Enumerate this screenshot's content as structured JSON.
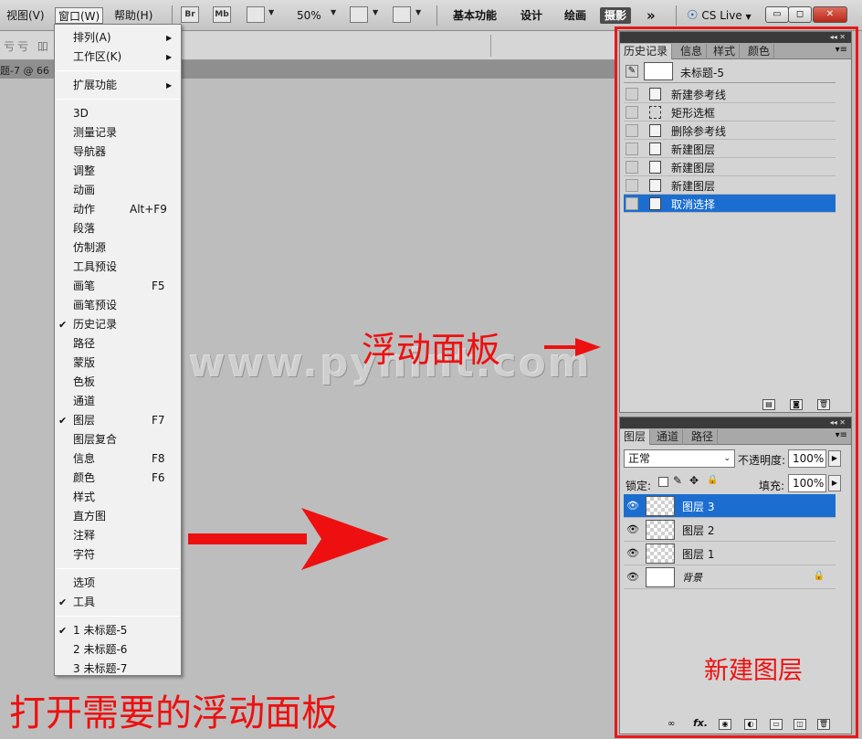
{
  "menubar": {
    "items": [
      "视图(V)",
      "窗口(W)",
      "帮助(H)"
    ],
    "icons": [
      "Br",
      "Mb"
    ],
    "zoom": "50%",
    "workspaces": [
      "基本功能",
      "设计",
      "绘画",
      "摄影"
    ],
    "more": "»",
    "cslive": "CS Live",
    "window_buttons": [
      "▭",
      "◻",
      "✕"
    ]
  },
  "optbar": {
    "fragment": "亏亏 吅"
  },
  "doctab": {
    "title": "题-7 @ 66"
  },
  "dropdown": {
    "sections": [
      [
        {
          "label": "排列(A)",
          "submenu": true
        },
        {
          "label": "工作区(K)",
          "submenu": true
        }
      ],
      [
        {
          "label": "扩展功能",
          "submenu": true
        }
      ],
      [
        {
          "label": "3D"
        },
        {
          "label": "测量记录"
        },
        {
          "label": "导航器"
        },
        {
          "label": "调整"
        },
        {
          "label": "动画"
        },
        {
          "label": "动作",
          "shortcut": "Alt+F9"
        },
        {
          "label": "段落"
        },
        {
          "label": "仿制源"
        },
        {
          "label": "工具预设"
        },
        {
          "label": "画笔",
          "shortcut": "F5"
        },
        {
          "label": "画笔预设"
        },
        {
          "label": "历史记录",
          "checked": true
        },
        {
          "label": "路径"
        },
        {
          "label": "蒙版"
        },
        {
          "label": "色板"
        },
        {
          "label": "通道"
        },
        {
          "label": "图层",
          "shortcut": "F7",
          "checked": true
        },
        {
          "label": "图层复合"
        },
        {
          "label": "信息",
          "shortcut": "F8"
        },
        {
          "label": "颜色",
          "shortcut": "F6"
        },
        {
          "label": "样式"
        },
        {
          "label": "直方图"
        },
        {
          "label": "注释"
        },
        {
          "label": "字符"
        }
      ],
      [
        {
          "label": "选项"
        },
        {
          "label": "工具",
          "checked": true
        }
      ],
      [
        {
          "label": "1 未标题-5",
          "checked": true
        },
        {
          "label": "2 未标题-6"
        },
        {
          "label": "3 未标题-7"
        }
      ]
    ],
    "submenu_arrow": "▶",
    "check": "✔"
  },
  "history_panel": {
    "tabs": [
      "历史记录",
      "信息",
      "样式",
      "颜色"
    ],
    "snapshot": "未标题-5",
    "states": [
      "新建参考线",
      "矩形选框",
      "删除参考线",
      "新建图层",
      "新建图层",
      "新建图层",
      "取消选择"
    ],
    "selected_state": "取消选择"
  },
  "layers_panel": {
    "tabs": [
      "图层",
      "通道",
      "路径"
    ],
    "blend_mode": "正常",
    "opacity_label": "不透明度:",
    "opacity": "100%",
    "lock_label": "锁定:",
    "fill_label": "填充:",
    "fill": "100%",
    "layers": [
      "图层 3",
      "图层 2",
      "图层 1",
      "背景"
    ],
    "selected_layer": "图层 3",
    "bottom_icons": [
      "fx."
    ]
  },
  "annotations": {
    "floating_panel": "浮动面板",
    "open_panels": "打开需要的浮动面板",
    "new_layer": "新建图层",
    "watermark": "www.pyhint.com",
    "accent": "#ee1010"
  }
}
